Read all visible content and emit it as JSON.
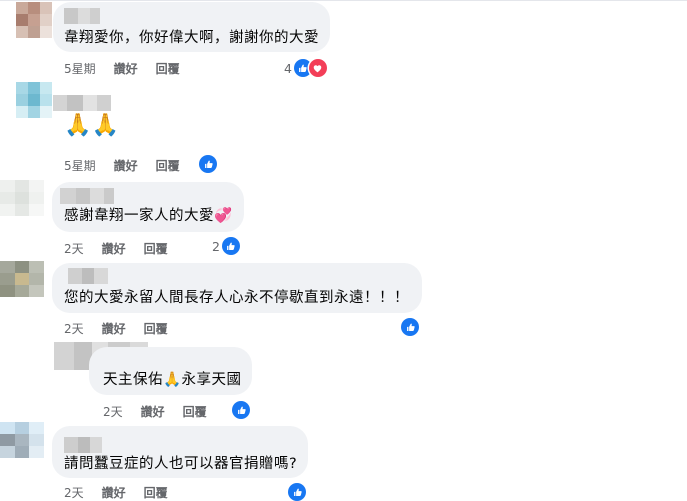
{
  "colors": {
    "bubble": "#f0f2f5",
    "meta": "#65676b",
    "like": "#1877f2",
    "love": "#f33e58"
  },
  "comments": [
    {
      "text": "韋翔愛你，你好偉大啊，謝謝你的大愛",
      "time": "5星期",
      "like_label": "讚好",
      "reply_label": "回覆",
      "reaction_count": "4",
      "reactions": [
        "like-icon",
        "love-icon"
      ]
    },
    {
      "text": "🙏🙏",
      "time": "5星期",
      "like_label": "讚好",
      "reply_label": "回覆",
      "reaction_count": "",
      "reactions": [
        "like-icon"
      ]
    },
    {
      "text": "感謝韋翔一家人的大愛💞",
      "time": "2天",
      "like_label": "讚好",
      "reply_label": "回覆",
      "reaction_count": "2",
      "reactions": [
        "like-icon"
      ]
    },
    {
      "text": "您的大愛永留人間長存人心永不停歇直到永遠！！！",
      "time": "2天",
      "like_label": "讚好",
      "reply_label": "回覆",
      "reaction_count": "",
      "reactions": [
        "like-icon"
      ]
    },
    {
      "text": "天主保佑🙏永享天國",
      "time": "2天",
      "like_label": "讚好",
      "reply_label": "回覆",
      "reaction_count": "",
      "reactions": [
        "like-icon"
      ]
    },
    {
      "text": "請問蠶豆症的人也可以器官捐贈嗎?",
      "time": "2天",
      "like_label": "讚好",
      "reply_label": "回覆",
      "reaction_count": "",
      "reactions": [
        "like-icon"
      ]
    }
  ]
}
